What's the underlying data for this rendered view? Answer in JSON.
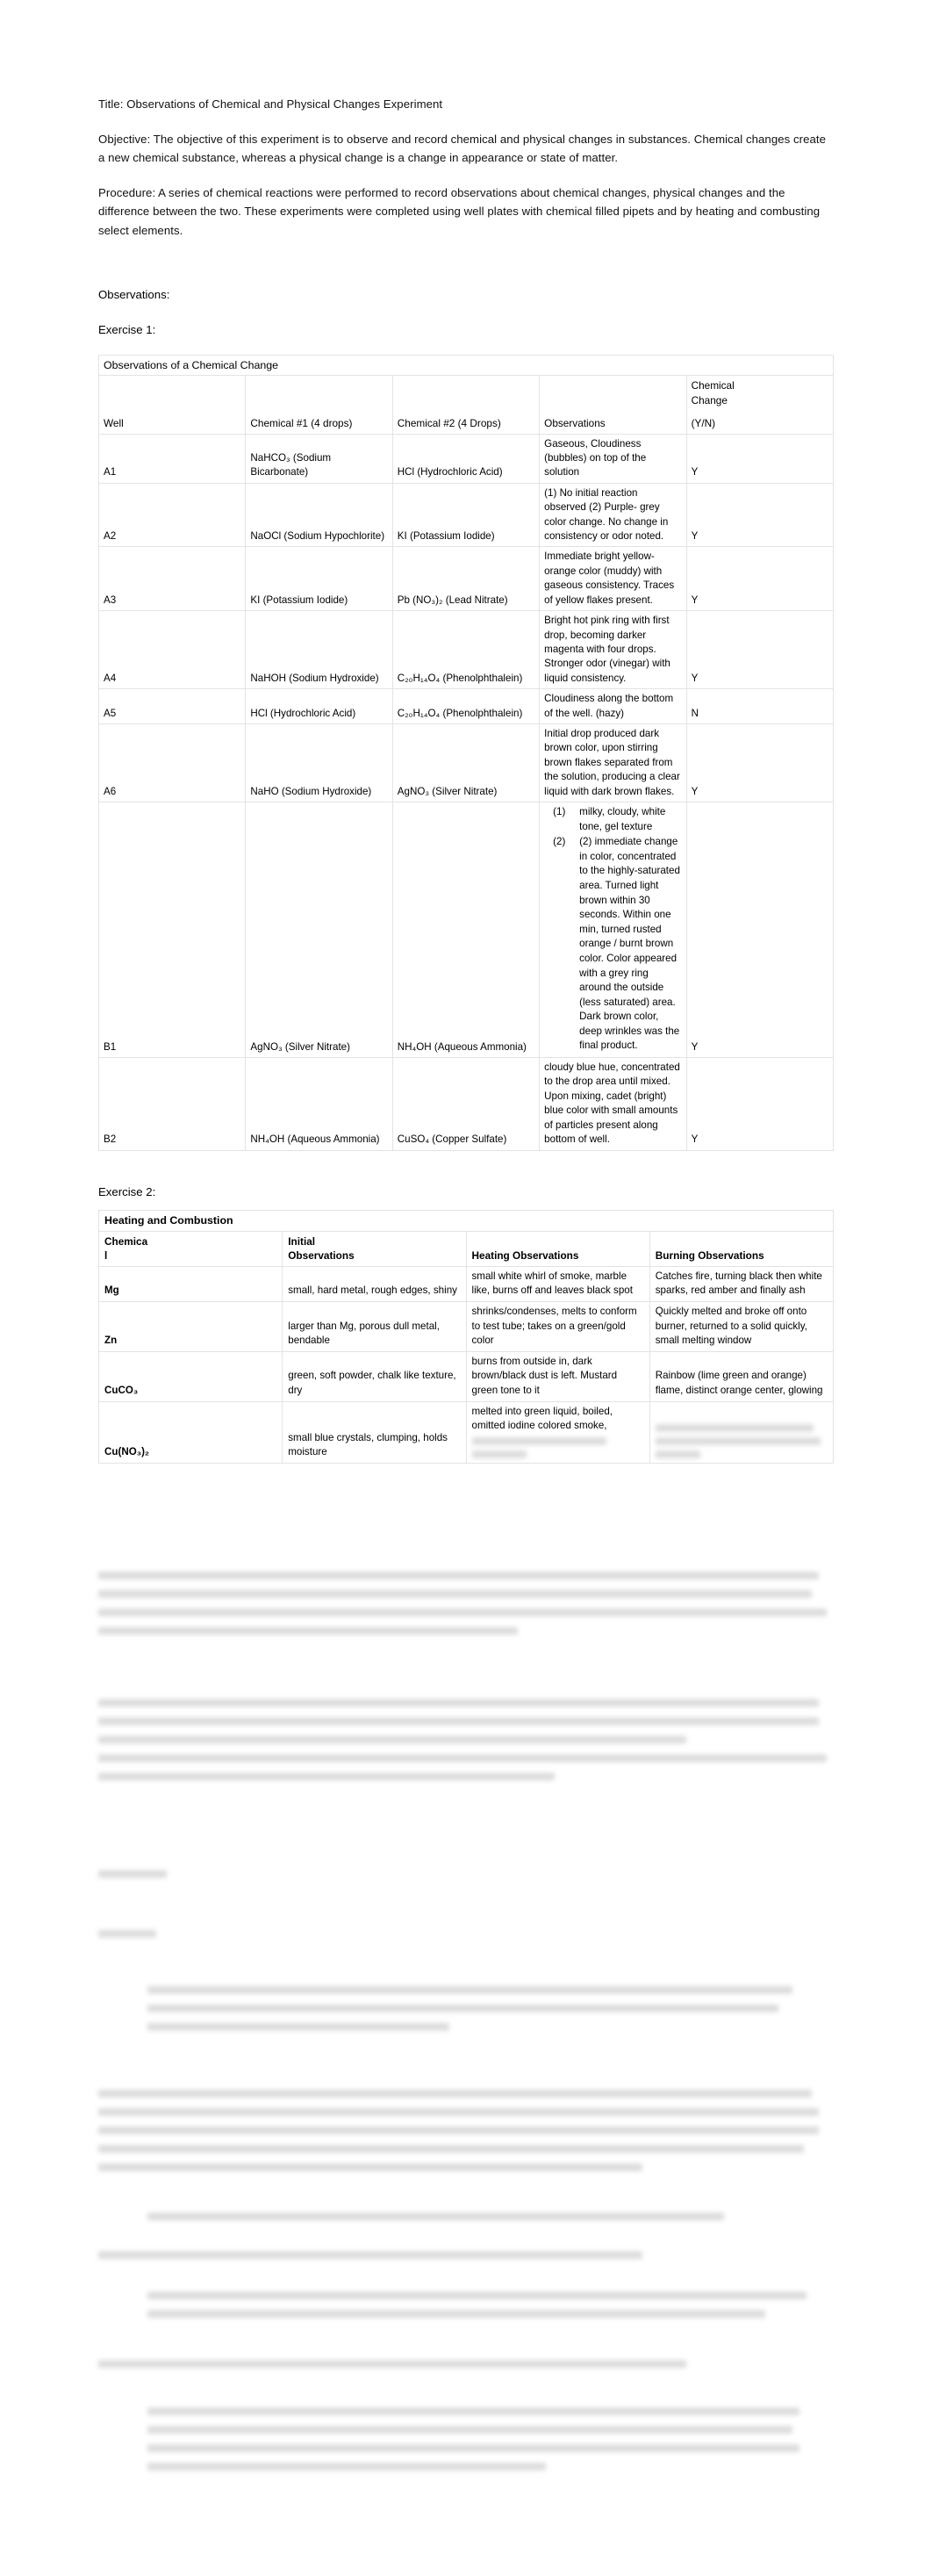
{
  "document": {
    "title_line": "Title: Observations of Chemical and Physical Changes Experiment",
    "objective": "Objective: The objective of this experiment is to observe and record chemical and physical changes in substances. Chemical changes create a new chemical substance, whereas a physical change is a change in appearance or state of matter.",
    "procedure": "Procedure: A series of chemical reactions were performed to record observations about chemical changes, physical changes and the difference between the two. These experiments were completed using well plates with chemical filled pipets and by heating and combusting select elements.",
    "observations_label": "Observations:",
    "exercise1_label": "Exercise 1:",
    "exercise2_label": "Exercise 2:"
  },
  "table1": {
    "caption": "Observations of a Chemical Change",
    "headers": {
      "well": "Well",
      "chem1": "Chemical #1 (4 drops)",
      "chem2": "Chemical #2 (4 Drops)",
      "observations": "Observations",
      "change_l1": "Chemical",
      "change_l2": "Change",
      "change_l3": "(Y/N)"
    },
    "rows": [
      {
        "well": "A1",
        "chem1": "NaHCO₃ (Sodium Bicarbonate)",
        "chem2": "HCl (Hydrochloric Acid)",
        "observations": "Gaseous, Cloudiness (bubbles) on top of the solution",
        "change": "Y"
      },
      {
        "well": "A2",
        "chem1": "NaOCl (Sodium Hypochlorite)",
        "chem2": "KI (Potassium Iodide)",
        "observations": "(1) No initial reaction observed (2) Purple- grey color change.  No change in consistency or odor noted.",
        "change": "Y"
      },
      {
        "well": "A3",
        "chem1": "KI (Potassium Iodide)",
        "chem2": "Pb (NO₃)₂ (Lead Nitrate)",
        "observations": "Immediate bright yellow-orange color (muddy) with gaseous consistency. Traces of yellow flakes present.",
        "change": "Y"
      },
      {
        "well": "A4",
        "chem1": "NaHOH (Sodium Hydroxide)",
        "chem2": "C₂₀H₁₄O₄ (Phenolphthalein)",
        "observations": "Bright hot pink ring with first drop, becoming darker magenta with four drops. Stronger odor (vinegar) with liquid consistency.",
        "change": "Y"
      },
      {
        "well": "A5",
        "chem1": "HCl (Hydrochloric Acid)",
        "chem2": "C₂₀H₁₄O₄ (Phenolphthalein)",
        "observations": "Cloudiness along the bottom of the well.  (hazy)",
        "change": "N"
      },
      {
        "well": "A6",
        "chem1": "NaHO (Sodium Hydroxide)",
        "chem2": "AgNO₃ (Silver Nitrate)",
        "observations": "Initial drop produced dark brown color, upon stirring brown flakes separated from the solution, producing a clear liquid with dark brown flakes.",
        "change": "Y"
      },
      {
        "well": "B1",
        "chem1": "AgNO₃ (Silver Nitrate)",
        "chem2": "NH₄OH (Aqueous Ammonia)",
        "observations_list": [
          "milky, cloudy, white tone, gel texture",
          "(2) immediate change in color, concentrated to the highly-saturated area.  Turned light brown within 30 seconds. Within one min, turned rusted orange / burnt brown color. Color appeared with a grey ring around the outside (less saturated) area.  Dark brown color, deep wrinkles was the final product."
        ],
        "change": "Y"
      },
      {
        "well": "B2",
        "chem1": "NH₄OH (Aqueous Ammonia)",
        "chem2": "CuSO₄ (Copper Sulfate)",
        "observations": "cloudy blue hue, concentrated to the drop area until mixed. Upon mixing, cadet (bright) blue color with small amounts of particles present along bottom of well.",
        "change": "Y"
      }
    ]
  },
  "table2": {
    "caption": "Heating and Combustion",
    "headers": {
      "chemical_l1": "Chemica",
      "chemical_l2": "l",
      "initial_l1": "Initial",
      "initial_l2": "Observations",
      "heating": "Heating Observations",
      "burning": "Burning Observations"
    },
    "rows": [
      {
        "chemical": "Mg",
        "initial": "small, hard metal, rough edges, shiny",
        "heating": "small white whirl of smoke, marble like, burns off and leaves black spot",
        "burning": "Catches fire, turning black then white sparks, red amber and finally ash"
      },
      {
        "chemical": "Zn",
        "initial": "larger than Mg, porous dull metal, bendable",
        "heating": "shrinks/condenses, melts to conform to test tube; takes on a green/gold color",
        "burning": "Quickly melted and broke off onto burner, returned to a solid quickly, small melting window"
      },
      {
        "chemical": "CuCO₃",
        "initial": "green, soft powder, chalk like texture, dry",
        "heating": "burns from outside in, dark brown/black dust is left.  Mustard green tone to it",
        "burning": "Rainbow (lime green and orange) flame, distinct orange center, glowing"
      },
      {
        "chemical": "Cu(NO₃)₂",
        "initial": "small blue crystals, clumping, holds moisture",
        "heating": "melted into green liquid, boiled, omitted iodine colored smoke,",
        "burning": ""
      }
    ]
  }
}
